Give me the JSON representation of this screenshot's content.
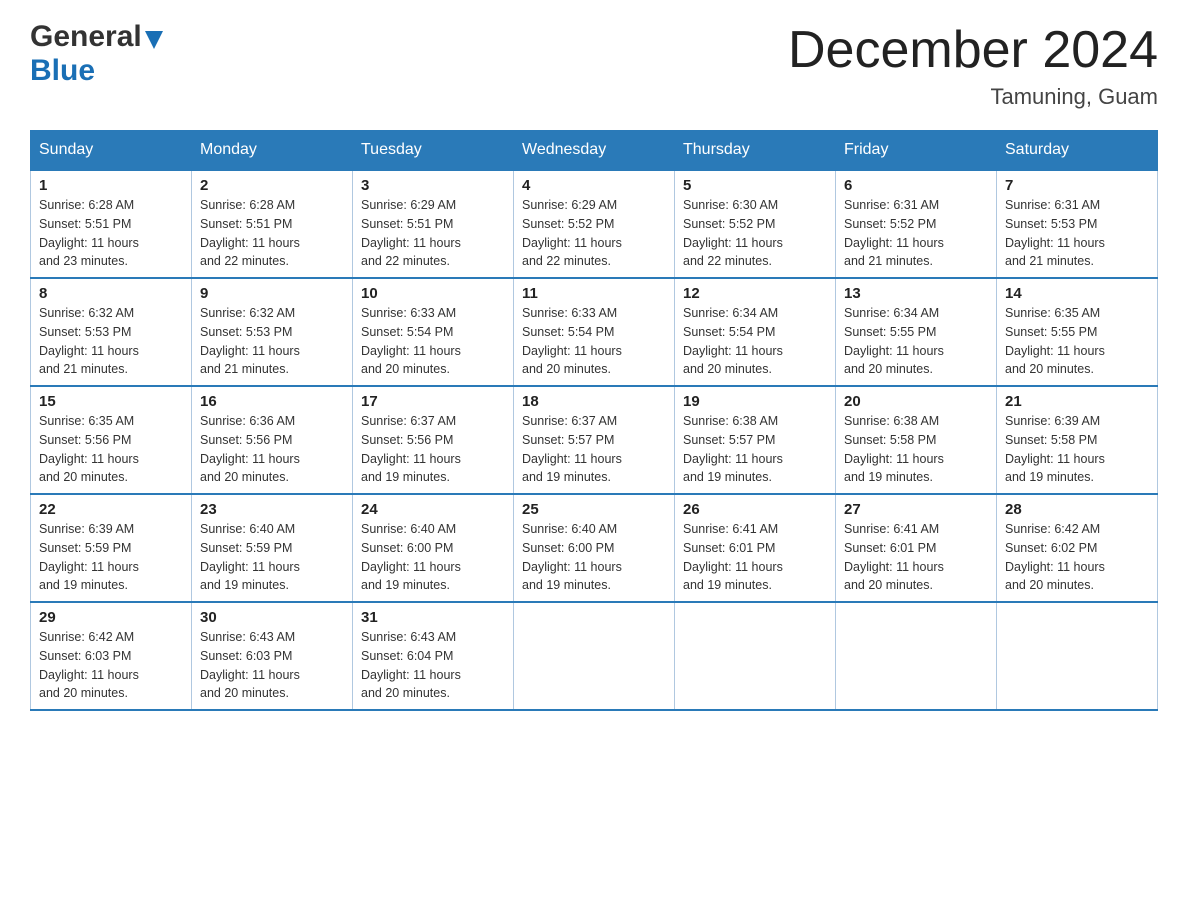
{
  "header": {
    "logo_general": "General",
    "logo_blue": "Blue",
    "title": "December 2024",
    "location": "Tamuning, Guam"
  },
  "days_of_week": [
    "Sunday",
    "Monday",
    "Tuesday",
    "Wednesday",
    "Thursday",
    "Friday",
    "Saturday"
  ],
  "weeks": [
    [
      {
        "day": "1",
        "sunrise": "6:28 AM",
        "sunset": "5:51 PM",
        "daylight": "11 hours and 23 minutes."
      },
      {
        "day": "2",
        "sunrise": "6:28 AM",
        "sunset": "5:51 PM",
        "daylight": "11 hours and 22 minutes."
      },
      {
        "day": "3",
        "sunrise": "6:29 AM",
        "sunset": "5:51 PM",
        "daylight": "11 hours and 22 minutes."
      },
      {
        "day": "4",
        "sunrise": "6:29 AM",
        "sunset": "5:52 PM",
        "daylight": "11 hours and 22 minutes."
      },
      {
        "day": "5",
        "sunrise": "6:30 AM",
        "sunset": "5:52 PM",
        "daylight": "11 hours and 22 minutes."
      },
      {
        "day": "6",
        "sunrise": "6:31 AM",
        "sunset": "5:52 PM",
        "daylight": "11 hours and 21 minutes."
      },
      {
        "day": "7",
        "sunrise": "6:31 AM",
        "sunset": "5:53 PM",
        "daylight": "11 hours and 21 minutes."
      }
    ],
    [
      {
        "day": "8",
        "sunrise": "6:32 AM",
        "sunset": "5:53 PM",
        "daylight": "11 hours and 21 minutes."
      },
      {
        "day": "9",
        "sunrise": "6:32 AM",
        "sunset": "5:53 PM",
        "daylight": "11 hours and 21 minutes."
      },
      {
        "day": "10",
        "sunrise": "6:33 AM",
        "sunset": "5:54 PM",
        "daylight": "11 hours and 20 minutes."
      },
      {
        "day": "11",
        "sunrise": "6:33 AM",
        "sunset": "5:54 PM",
        "daylight": "11 hours and 20 minutes."
      },
      {
        "day": "12",
        "sunrise": "6:34 AM",
        "sunset": "5:54 PM",
        "daylight": "11 hours and 20 minutes."
      },
      {
        "day": "13",
        "sunrise": "6:34 AM",
        "sunset": "5:55 PM",
        "daylight": "11 hours and 20 minutes."
      },
      {
        "day": "14",
        "sunrise": "6:35 AM",
        "sunset": "5:55 PM",
        "daylight": "11 hours and 20 minutes."
      }
    ],
    [
      {
        "day": "15",
        "sunrise": "6:35 AM",
        "sunset": "5:56 PM",
        "daylight": "11 hours and 20 minutes."
      },
      {
        "day": "16",
        "sunrise": "6:36 AM",
        "sunset": "5:56 PM",
        "daylight": "11 hours and 20 minutes."
      },
      {
        "day": "17",
        "sunrise": "6:37 AM",
        "sunset": "5:56 PM",
        "daylight": "11 hours and 19 minutes."
      },
      {
        "day": "18",
        "sunrise": "6:37 AM",
        "sunset": "5:57 PM",
        "daylight": "11 hours and 19 minutes."
      },
      {
        "day": "19",
        "sunrise": "6:38 AM",
        "sunset": "5:57 PM",
        "daylight": "11 hours and 19 minutes."
      },
      {
        "day": "20",
        "sunrise": "6:38 AM",
        "sunset": "5:58 PM",
        "daylight": "11 hours and 19 minutes."
      },
      {
        "day": "21",
        "sunrise": "6:39 AM",
        "sunset": "5:58 PM",
        "daylight": "11 hours and 19 minutes."
      }
    ],
    [
      {
        "day": "22",
        "sunrise": "6:39 AM",
        "sunset": "5:59 PM",
        "daylight": "11 hours and 19 minutes."
      },
      {
        "day": "23",
        "sunrise": "6:40 AM",
        "sunset": "5:59 PM",
        "daylight": "11 hours and 19 minutes."
      },
      {
        "day": "24",
        "sunrise": "6:40 AM",
        "sunset": "6:00 PM",
        "daylight": "11 hours and 19 minutes."
      },
      {
        "day": "25",
        "sunrise": "6:40 AM",
        "sunset": "6:00 PM",
        "daylight": "11 hours and 19 minutes."
      },
      {
        "day": "26",
        "sunrise": "6:41 AM",
        "sunset": "6:01 PM",
        "daylight": "11 hours and 19 minutes."
      },
      {
        "day": "27",
        "sunrise": "6:41 AM",
        "sunset": "6:01 PM",
        "daylight": "11 hours and 20 minutes."
      },
      {
        "day": "28",
        "sunrise": "6:42 AM",
        "sunset": "6:02 PM",
        "daylight": "11 hours and 20 minutes."
      }
    ],
    [
      {
        "day": "29",
        "sunrise": "6:42 AM",
        "sunset": "6:03 PM",
        "daylight": "11 hours and 20 minutes."
      },
      {
        "day": "30",
        "sunrise": "6:43 AM",
        "sunset": "6:03 PM",
        "daylight": "11 hours and 20 minutes."
      },
      {
        "day": "31",
        "sunrise": "6:43 AM",
        "sunset": "6:04 PM",
        "daylight": "11 hours and 20 minutes."
      },
      null,
      null,
      null,
      null
    ]
  ],
  "labels": {
    "sunrise": "Sunrise:",
    "sunset": "Sunset:",
    "daylight": "Daylight:"
  }
}
